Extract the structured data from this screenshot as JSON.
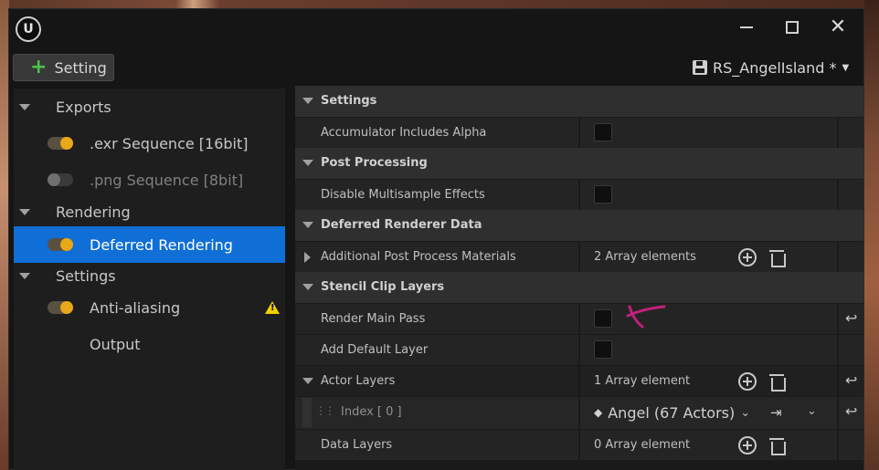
{
  "toolbar": {
    "add_label": "Setting",
    "preset_name": "RS_AngelIsland *"
  },
  "tree": {
    "groups": [
      {
        "label": "Exports"
      },
      {
        "label": "Rendering"
      },
      {
        "label": "Settings"
      }
    ],
    "items": [
      {
        "label": ".exr Sequence [16bit]",
        "enabled": true
      },
      {
        "label": ".png Sequence [8bit]",
        "enabled": false
      },
      {
        "label": "Deferred Rendering",
        "enabled": true,
        "selected": true
      },
      {
        "label": "Anti-aliasing",
        "enabled": true,
        "warning": true
      },
      {
        "label": "Output"
      }
    ]
  },
  "details": {
    "cat_settings": "Settings",
    "accumulator": "Accumulator Includes Alpha",
    "cat_post": "Post Processing",
    "disable_msaa": "Disable Multisample Effects",
    "cat_deferred": "Deferred Renderer Data",
    "additional_ppm": "Additional Post Process Materials",
    "additional_ppm_value": "2 Array elements",
    "cat_stencil": "Stencil Clip Layers",
    "render_main_pass": "Render Main Pass",
    "add_default_layer": "Add Default Layer",
    "actor_layers": "Actor Layers",
    "actor_layers_value": "1 Array element",
    "index_label": "Index [ 0 ]",
    "index_value": "Angel (67 Actors)",
    "data_layers": "Data Layers",
    "data_layers_value": "0 Array element"
  },
  "colors": {
    "accent_selected": "#0f6fd6",
    "toggle_on": "#e8a81a",
    "add_plus": "#4cc04c",
    "warning": "#f0d000",
    "annotation": "#c0207a"
  }
}
